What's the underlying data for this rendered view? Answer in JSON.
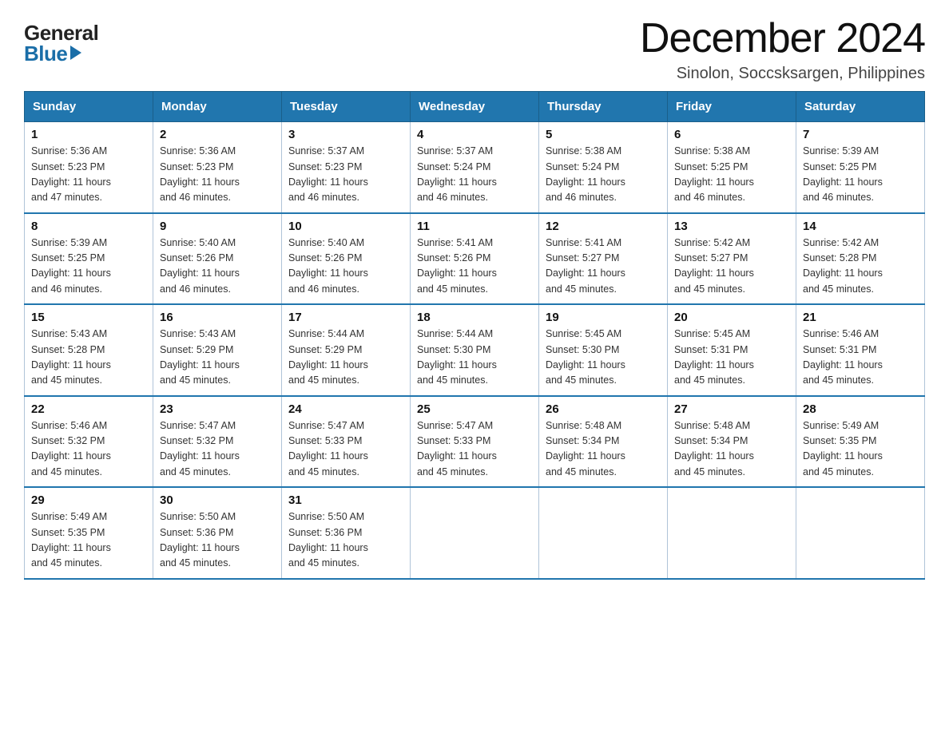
{
  "logo": {
    "general": "General",
    "blue": "Blue"
  },
  "title": {
    "month": "December 2024",
    "location": "Sinolon, Soccsksargen, Philippines"
  },
  "weekdays": [
    "Sunday",
    "Monday",
    "Tuesday",
    "Wednesday",
    "Thursday",
    "Friday",
    "Saturday"
  ],
  "weeks": [
    [
      {
        "day": "1",
        "sunrise": "5:36 AM",
        "sunset": "5:23 PM",
        "daylight": "11 hours and 47 minutes."
      },
      {
        "day": "2",
        "sunrise": "5:36 AM",
        "sunset": "5:23 PM",
        "daylight": "11 hours and 46 minutes."
      },
      {
        "day": "3",
        "sunrise": "5:37 AM",
        "sunset": "5:23 PM",
        "daylight": "11 hours and 46 minutes."
      },
      {
        "day": "4",
        "sunrise": "5:37 AM",
        "sunset": "5:24 PM",
        "daylight": "11 hours and 46 minutes."
      },
      {
        "day": "5",
        "sunrise": "5:38 AM",
        "sunset": "5:24 PM",
        "daylight": "11 hours and 46 minutes."
      },
      {
        "day": "6",
        "sunrise": "5:38 AM",
        "sunset": "5:25 PM",
        "daylight": "11 hours and 46 minutes."
      },
      {
        "day": "7",
        "sunrise": "5:39 AM",
        "sunset": "5:25 PM",
        "daylight": "11 hours and 46 minutes."
      }
    ],
    [
      {
        "day": "8",
        "sunrise": "5:39 AM",
        "sunset": "5:25 PM",
        "daylight": "11 hours and 46 minutes."
      },
      {
        "day": "9",
        "sunrise": "5:40 AM",
        "sunset": "5:26 PM",
        "daylight": "11 hours and 46 minutes."
      },
      {
        "day": "10",
        "sunrise": "5:40 AM",
        "sunset": "5:26 PM",
        "daylight": "11 hours and 46 minutes."
      },
      {
        "day": "11",
        "sunrise": "5:41 AM",
        "sunset": "5:26 PM",
        "daylight": "11 hours and 45 minutes."
      },
      {
        "day": "12",
        "sunrise": "5:41 AM",
        "sunset": "5:27 PM",
        "daylight": "11 hours and 45 minutes."
      },
      {
        "day": "13",
        "sunrise": "5:42 AM",
        "sunset": "5:27 PM",
        "daylight": "11 hours and 45 minutes."
      },
      {
        "day": "14",
        "sunrise": "5:42 AM",
        "sunset": "5:28 PM",
        "daylight": "11 hours and 45 minutes."
      }
    ],
    [
      {
        "day": "15",
        "sunrise": "5:43 AM",
        "sunset": "5:28 PM",
        "daylight": "11 hours and 45 minutes."
      },
      {
        "day": "16",
        "sunrise": "5:43 AM",
        "sunset": "5:29 PM",
        "daylight": "11 hours and 45 minutes."
      },
      {
        "day": "17",
        "sunrise": "5:44 AM",
        "sunset": "5:29 PM",
        "daylight": "11 hours and 45 minutes."
      },
      {
        "day": "18",
        "sunrise": "5:44 AM",
        "sunset": "5:30 PM",
        "daylight": "11 hours and 45 minutes."
      },
      {
        "day": "19",
        "sunrise": "5:45 AM",
        "sunset": "5:30 PM",
        "daylight": "11 hours and 45 minutes."
      },
      {
        "day": "20",
        "sunrise": "5:45 AM",
        "sunset": "5:31 PM",
        "daylight": "11 hours and 45 minutes."
      },
      {
        "day": "21",
        "sunrise": "5:46 AM",
        "sunset": "5:31 PM",
        "daylight": "11 hours and 45 minutes."
      }
    ],
    [
      {
        "day": "22",
        "sunrise": "5:46 AM",
        "sunset": "5:32 PM",
        "daylight": "11 hours and 45 minutes."
      },
      {
        "day": "23",
        "sunrise": "5:47 AM",
        "sunset": "5:32 PM",
        "daylight": "11 hours and 45 minutes."
      },
      {
        "day": "24",
        "sunrise": "5:47 AM",
        "sunset": "5:33 PM",
        "daylight": "11 hours and 45 minutes."
      },
      {
        "day": "25",
        "sunrise": "5:47 AM",
        "sunset": "5:33 PM",
        "daylight": "11 hours and 45 minutes."
      },
      {
        "day": "26",
        "sunrise": "5:48 AM",
        "sunset": "5:34 PM",
        "daylight": "11 hours and 45 minutes."
      },
      {
        "day": "27",
        "sunrise": "5:48 AM",
        "sunset": "5:34 PM",
        "daylight": "11 hours and 45 minutes."
      },
      {
        "day": "28",
        "sunrise": "5:49 AM",
        "sunset": "5:35 PM",
        "daylight": "11 hours and 45 minutes."
      }
    ],
    [
      {
        "day": "29",
        "sunrise": "5:49 AM",
        "sunset": "5:35 PM",
        "daylight": "11 hours and 45 minutes."
      },
      {
        "day": "30",
        "sunrise": "5:50 AM",
        "sunset": "5:36 PM",
        "daylight": "11 hours and 45 minutes."
      },
      {
        "day": "31",
        "sunrise": "5:50 AM",
        "sunset": "5:36 PM",
        "daylight": "11 hours and 45 minutes."
      },
      null,
      null,
      null,
      null
    ]
  ],
  "labels": {
    "sunrise": "Sunrise:",
    "sunset": "Sunset:",
    "daylight": "Daylight:"
  }
}
